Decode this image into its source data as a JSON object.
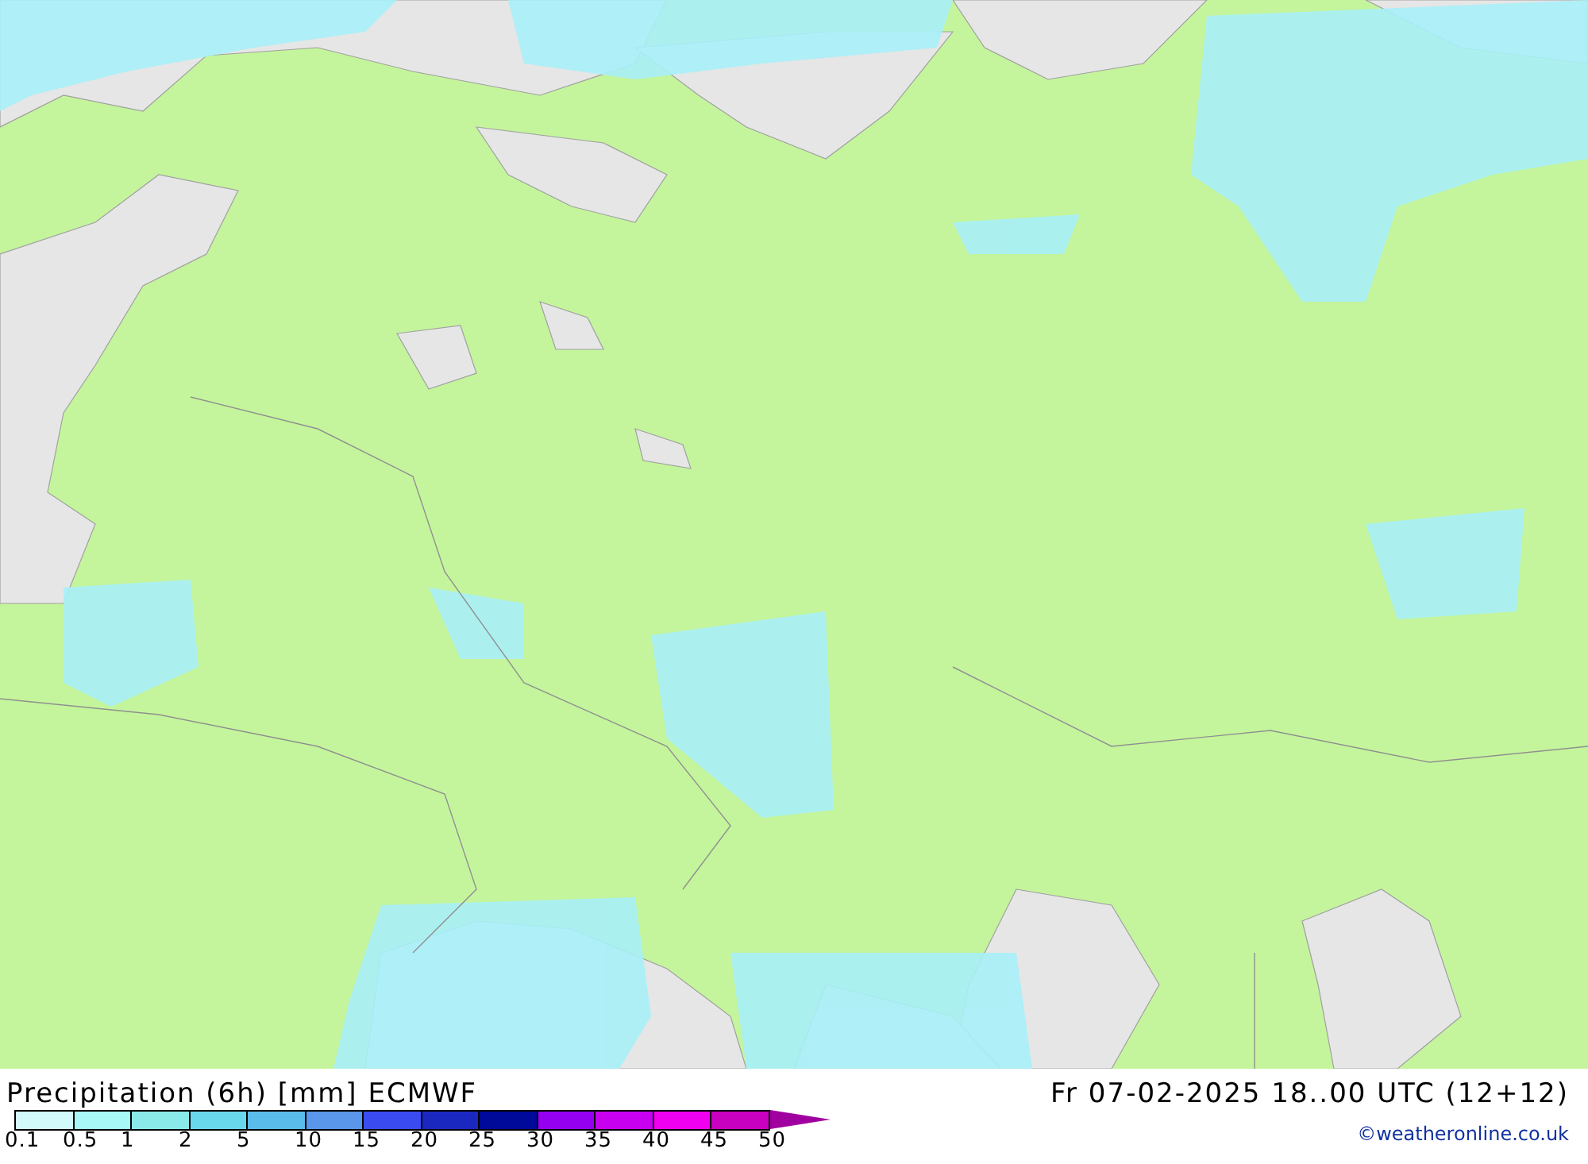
{
  "footer": {
    "title": "Precipitation (6h) [mm] ECMWF",
    "valid_time": "Fr 07-02-2025 18..00 UTC (12+12)",
    "credit": "©weatheronline.co.uk"
  },
  "legend": {
    "bins": [
      {
        "color": "#d2fafa"
      },
      {
        "color": "#a8f8f8"
      },
      {
        "color": "#8aeaea"
      },
      {
        "color": "#6ad8ec"
      },
      {
        "color": "#5abcea"
      },
      {
        "color": "#5a96ea"
      },
      {
        "color": "#3a4cf0"
      },
      {
        "color": "#1a28c0"
      },
      {
        "color": "#000a9a"
      },
      {
        "color": "#9600f0"
      },
      {
        "color": "#c800f0"
      },
      {
        "color": "#f000f0"
      },
      {
        "color": "#c800c0"
      }
    ],
    "overflow": {
      "color": "#a000a0"
    },
    "ticks": [
      "0.1",
      "0.5",
      "1",
      "2",
      "5",
      "10",
      "15",
      "20",
      "25",
      "30",
      "35",
      "40",
      "45",
      "50"
    ]
  }
}
